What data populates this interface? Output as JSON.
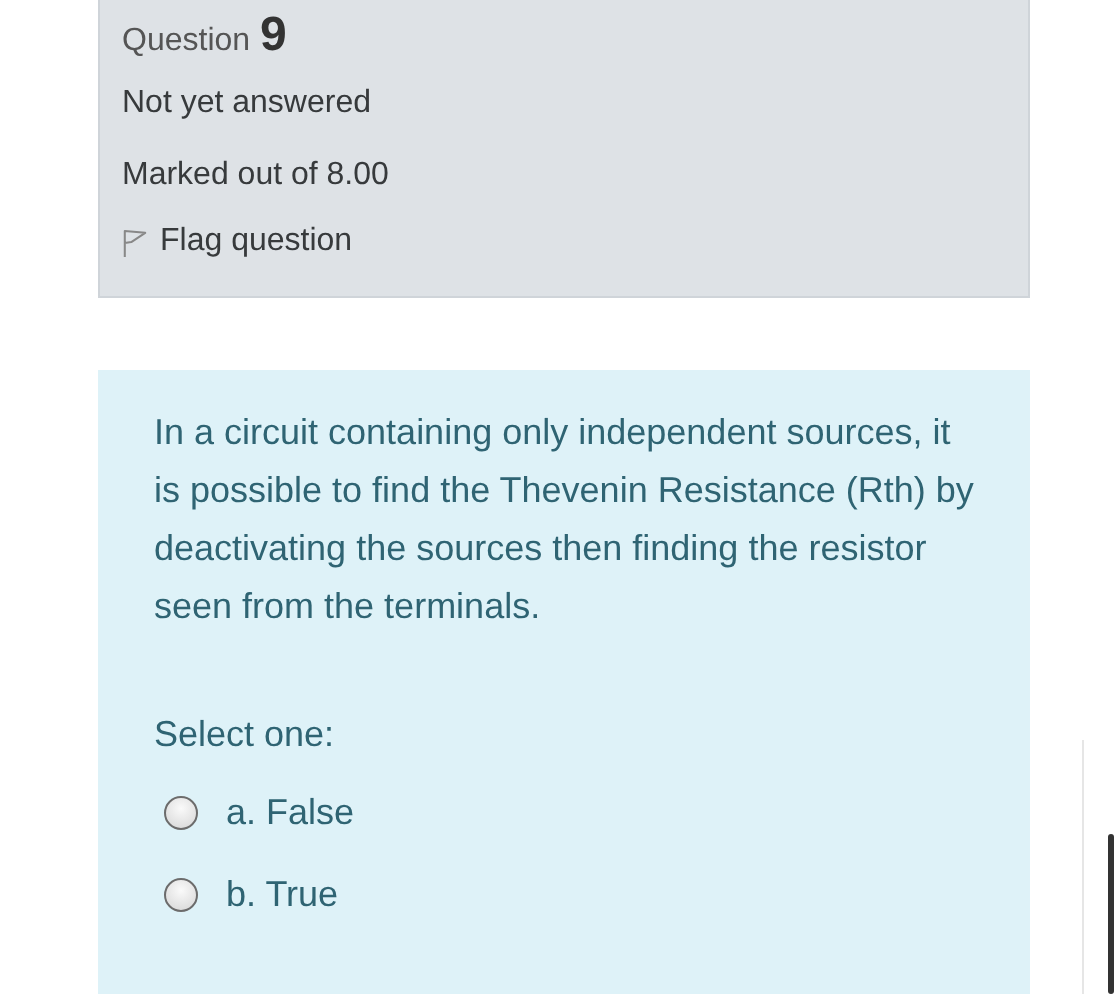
{
  "info": {
    "question_label": "Question",
    "question_number": "9",
    "status": "Not yet answered",
    "marks": "Marked out of 8.00",
    "flag": {
      "label": "Flag question",
      "flagged": false
    }
  },
  "content": {
    "question_text": "In a circuit containing only independent sources, it is possible to find the Thevenin Resistance (Rth) by deactivating the sources then finding the resistor seen from the terminals.",
    "prompt": "Select one:",
    "options": [
      {
        "label": "a. False",
        "selected": false
      },
      {
        "label": "b. True",
        "selected": false
      }
    ]
  }
}
